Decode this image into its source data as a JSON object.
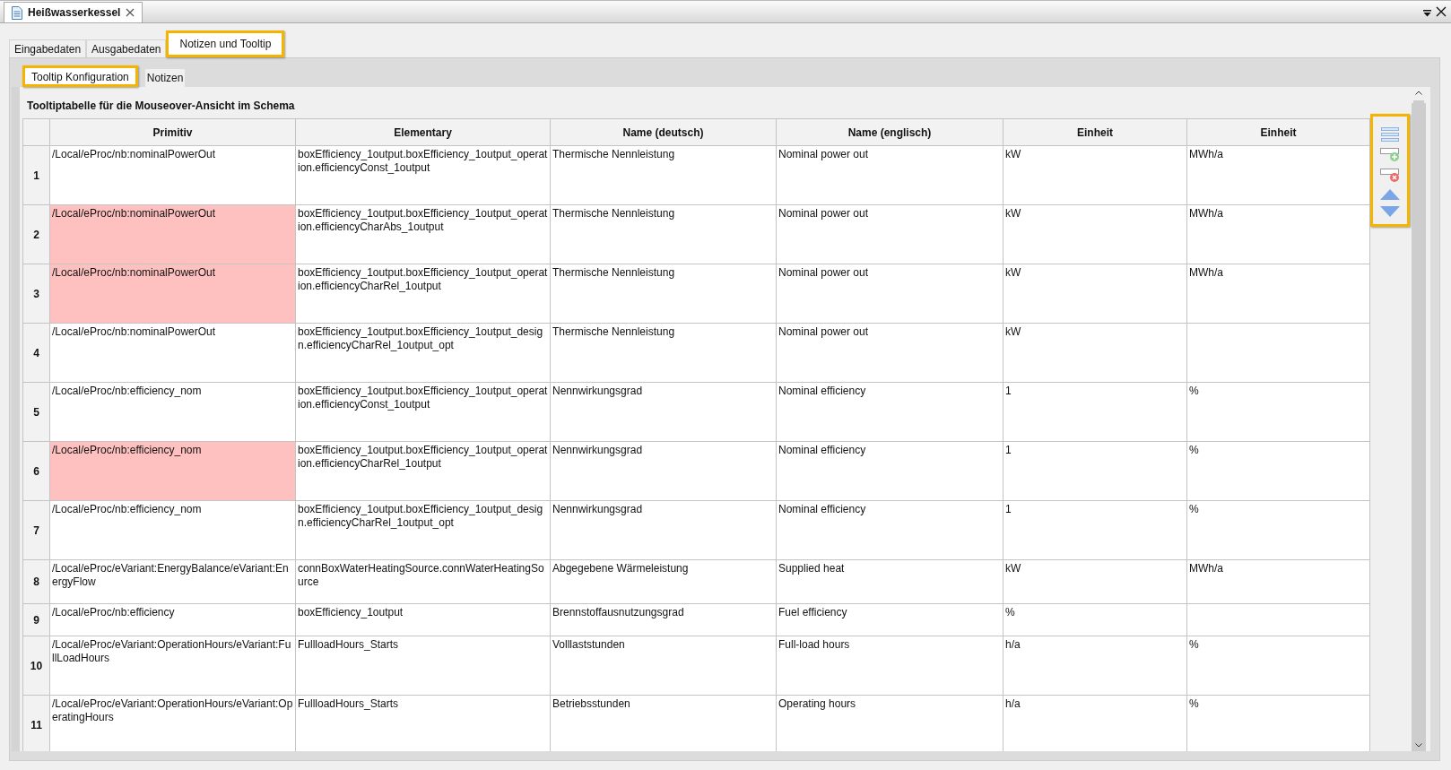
{
  "document_tab": {
    "title": "Heißwasserkessel"
  },
  "tabs": [
    {
      "label": "Eingabedaten",
      "selected": false,
      "highlighted": false
    },
    {
      "label": "Ausgabedaten",
      "selected": false,
      "highlighted": false
    },
    {
      "label": "Notizen und Tooltip",
      "selected": true,
      "highlighted": true
    }
  ],
  "subtabs": [
    {
      "label": "Tooltip Konfiguration",
      "selected": true,
      "highlighted": true
    },
    {
      "label": "Notizen",
      "selected": false,
      "highlighted": false
    }
  ],
  "section_title": "Tooltiptabelle für die Mouseover-Ansicht im Schema",
  "table": {
    "columns": [
      "Primitiv",
      "Elementary",
      "Name (deutsch)",
      "Name (englisch)",
      "Einheit",
      "Einheit"
    ],
    "rows": [
      {
        "number": "1",
        "flagged": false,
        "cells": [
          "/Local/eProc/nb:nominalPowerOut",
          "boxEfficiency_1output.boxEfficiency_1output_operation.efficiencyConst_1output",
          "Thermische Nennleistung",
          "Nominal power out",
          "kW",
          "MWh/a"
        ]
      },
      {
        "number": "2",
        "flagged": true,
        "cells": [
          "/Local/eProc/nb:nominalPowerOut",
          "boxEfficiency_1output.boxEfficiency_1output_operation.efficiencyCharAbs_1output",
          "Thermische Nennleistung",
          "Nominal power out",
          "kW",
          "MWh/a"
        ]
      },
      {
        "number": "3",
        "flagged": true,
        "cells": [
          "/Local/eProc/nb:nominalPowerOut",
          "boxEfficiency_1output.boxEfficiency_1output_operation.efficiencyCharRel_1output",
          "Thermische Nennleistung",
          "Nominal power out",
          "kW",
          "MWh/a"
        ]
      },
      {
        "number": "4",
        "flagged": false,
        "cells": [
          "/Local/eProc/nb:nominalPowerOut",
          "boxEfficiency_1output.boxEfficiency_1output_design.efficiencyCharRel_1output_opt",
          "Thermische Nennleistung",
          "Nominal power out",
          "kW",
          ""
        ]
      },
      {
        "number": "5",
        "flagged": false,
        "cells": [
          "/Local/eProc/nb:efficiency_nom",
          "boxEfficiency_1output.boxEfficiency_1output_operation.efficiencyConst_1output",
          "Nennwirkungsgrad",
          "Nominal efficiency",
          "1",
          "%"
        ]
      },
      {
        "number": "6",
        "flagged": true,
        "cells": [
          "/Local/eProc/nb:efficiency_nom",
          "boxEfficiency_1output.boxEfficiency_1output_operation.efficiencyCharRel_1output",
          "Nennwirkungsgrad",
          "Nominal efficiency",
          "1",
          "%"
        ]
      },
      {
        "number": "7",
        "flagged": false,
        "cells": [
          "/Local/eProc/nb:efficiency_nom",
          "boxEfficiency_1output.boxEfficiency_1output_design.efficiencyCharRel_1output_opt",
          "Nennwirkungsgrad",
          "Nominal efficiency",
          "1",
          "%"
        ]
      },
      {
        "number": "8",
        "flagged": false,
        "cells": [
          "/Local/eProc/eVariant:EnergyBalance/eVariant:EnergyFlow",
          "connBoxWaterHeatingSource.connWaterHeatingSource",
          "Abgegebene Wärmeleistung",
          "Supplied heat",
          "kW",
          "MWh/a"
        ]
      },
      {
        "number": "9",
        "flagged": false,
        "cells": [
          "/Local/eProc/nb:efficiency",
          "boxEfficiency_1output",
          "Brennstoffausnutzungsgrad",
          "Fuel efficiency",
          "%",
          ""
        ]
      },
      {
        "number": "10",
        "flagged": false,
        "cells": [
          "/Local/eProc/eVariant:OperationHours/eVariant:FullLoadHours",
          "FullloadHours_Starts",
          "Volllaststunden",
          "Full-load hours",
          "h/a",
          "%"
        ]
      },
      {
        "number": "11",
        "flagged": false,
        "cells": [
          "/Local/eProc/eVariant:OperationHours/eVariant:OperatingHours",
          "FullloadHours_Starts",
          "Betriebsstunden",
          "Operating hours",
          "h/a",
          "%"
        ]
      }
    ]
  },
  "toolbar": {
    "highlighted": true
  }
}
